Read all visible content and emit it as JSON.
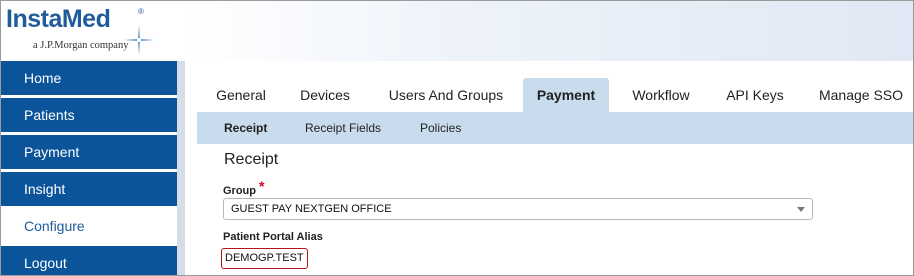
{
  "brand": {
    "name": "InstaMed",
    "registered": "®",
    "tagline": "a J.P.Morgan company"
  },
  "sidebar": {
    "items": [
      {
        "label": "Home"
      },
      {
        "label": "Patients"
      },
      {
        "label": "Payment"
      },
      {
        "label": "Insight"
      },
      {
        "label": "Configure"
      },
      {
        "label": "Logout"
      }
    ]
  },
  "tabs": [
    {
      "label": "General"
    },
    {
      "label": "Devices"
    },
    {
      "label": "Users And Groups"
    },
    {
      "label": "Payment"
    },
    {
      "label": "Workflow"
    },
    {
      "label": "API Keys"
    },
    {
      "label": "Manage SSO"
    }
  ],
  "subtabs": [
    {
      "label": "Receipt"
    },
    {
      "label": "Receipt Fields"
    },
    {
      "label": "Policies"
    }
  ],
  "form": {
    "title": "Receipt",
    "group_label": "Group",
    "required_mark": "*",
    "group_value": "GUEST PAY NEXTGEN OFFICE",
    "alias_label": "Patient Portal Alias",
    "alias_value": "DEMOGP.TEST"
  },
  "colors": {
    "nav_bg": "#0b5499",
    "accent": "#c8dced",
    "required": "#d0021b",
    "brand": "#1f5c99"
  }
}
